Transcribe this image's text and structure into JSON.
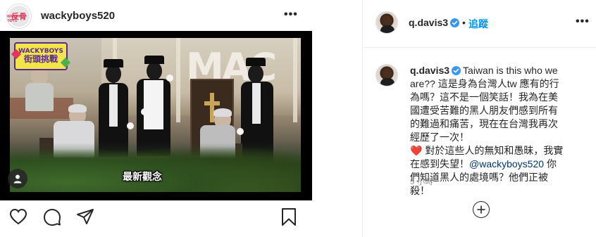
{
  "left_post": {
    "username": "wackyboys520",
    "avatar_logo_text": "反骨",
    "avatar_logo_sub": "WACKY BOYS",
    "more_label": "•••",
    "video": {
      "badge_top": "WACKYBOYS",
      "badge_bottom": "街頭挑戰",
      "store_sign": "MAC",
      "caption": "最新觀念"
    },
    "actions": [
      "like-icon",
      "comment-icon",
      "share-icon",
      "save-icon"
    ]
  },
  "right_panel": {
    "header": {
      "username": "q.davis3",
      "separator": "•",
      "follow_label": "追蹤",
      "more_label": "•••"
    },
    "comment": {
      "username": "q.davis3",
      "text_1": "Taiwan is this who we are?? 這是身為台灣人tw 應有的行為嗎？這不是一個笑話！我為在美國遭受苦難的黑人朋友們感到所有的難過和痛苦，現在在台灣我再次經歷了一次！",
      "heart": "❤️",
      "text_2": "對於這些人的無知和愚昧，我實在感到失望！",
      "mention": "@wackyboys520",
      "text_3": "你們知道黑人的處境嗎？他們正被殺！",
      "time": "5 小時"
    },
    "colors": {
      "follow": "#0095f6",
      "verified": "#3897f0",
      "mention": "#00376b",
      "muted": "#8e8e8e"
    }
  }
}
